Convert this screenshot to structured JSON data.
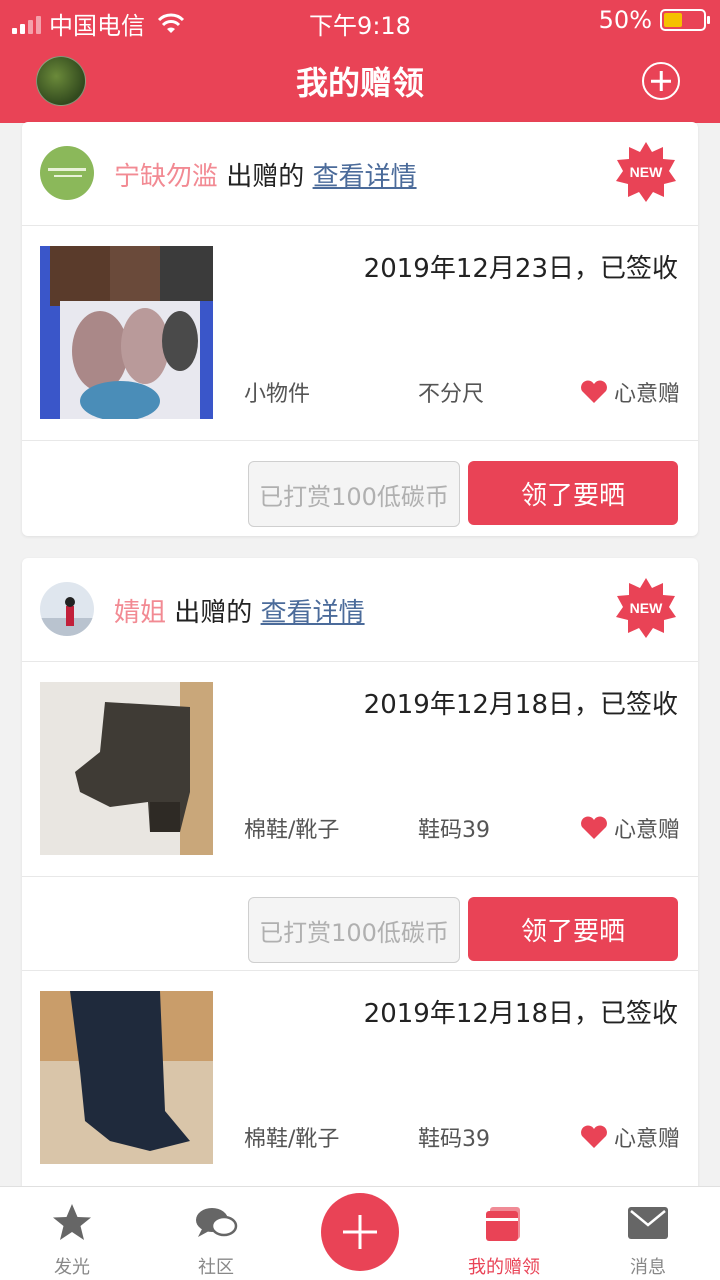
{
  "status_bar": {
    "carrier": "中国电信",
    "time": "下午9:18",
    "battery": "50%"
  },
  "header": {
    "title": "我的赠领"
  },
  "gifts": [
    {
      "giver_name": "宁缺勿滥",
      "verb": "出赠的",
      "details_link": "查看详情",
      "badge": "NEW",
      "items": [
        {
          "date": "2019年12月23日，已签收",
          "category": "小物件",
          "size": "不分尺",
          "type": "心意赠",
          "reward_button": "已打赏100低碳币",
          "show_button": "领了要晒"
        }
      ]
    },
    {
      "giver_name": "婧姐",
      "verb": "出赠的",
      "details_link": "查看详情",
      "badge": "NEW",
      "items": [
        {
          "date": "2019年12月18日，已签收",
          "category": "棉鞋/靴子",
          "size": "鞋码39",
          "type": "心意赠",
          "reward_button": "已打赏100低碳币",
          "show_button": "领了要晒"
        },
        {
          "date": "2019年12月18日，已签收",
          "category": "棉鞋/靴子",
          "size": "鞋码39",
          "type": "心意赠"
        }
      ]
    }
  ],
  "tabbar": {
    "tabs": [
      {
        "label": "发光",
        "icon": "star-icon"
      },
      {
        "label": "社区",
        "icon": "chat-bubbles-icon"
      },
      {
        "label": "",
        "icon": "plus-icon"
      },
      {
        "label": "我的赠领",
        "icon": "gift-cards-icon",
        "active": true
      },
      {
        "label": "消息",
        "icon": "mail-icon"
      }
    ]
  }
}
